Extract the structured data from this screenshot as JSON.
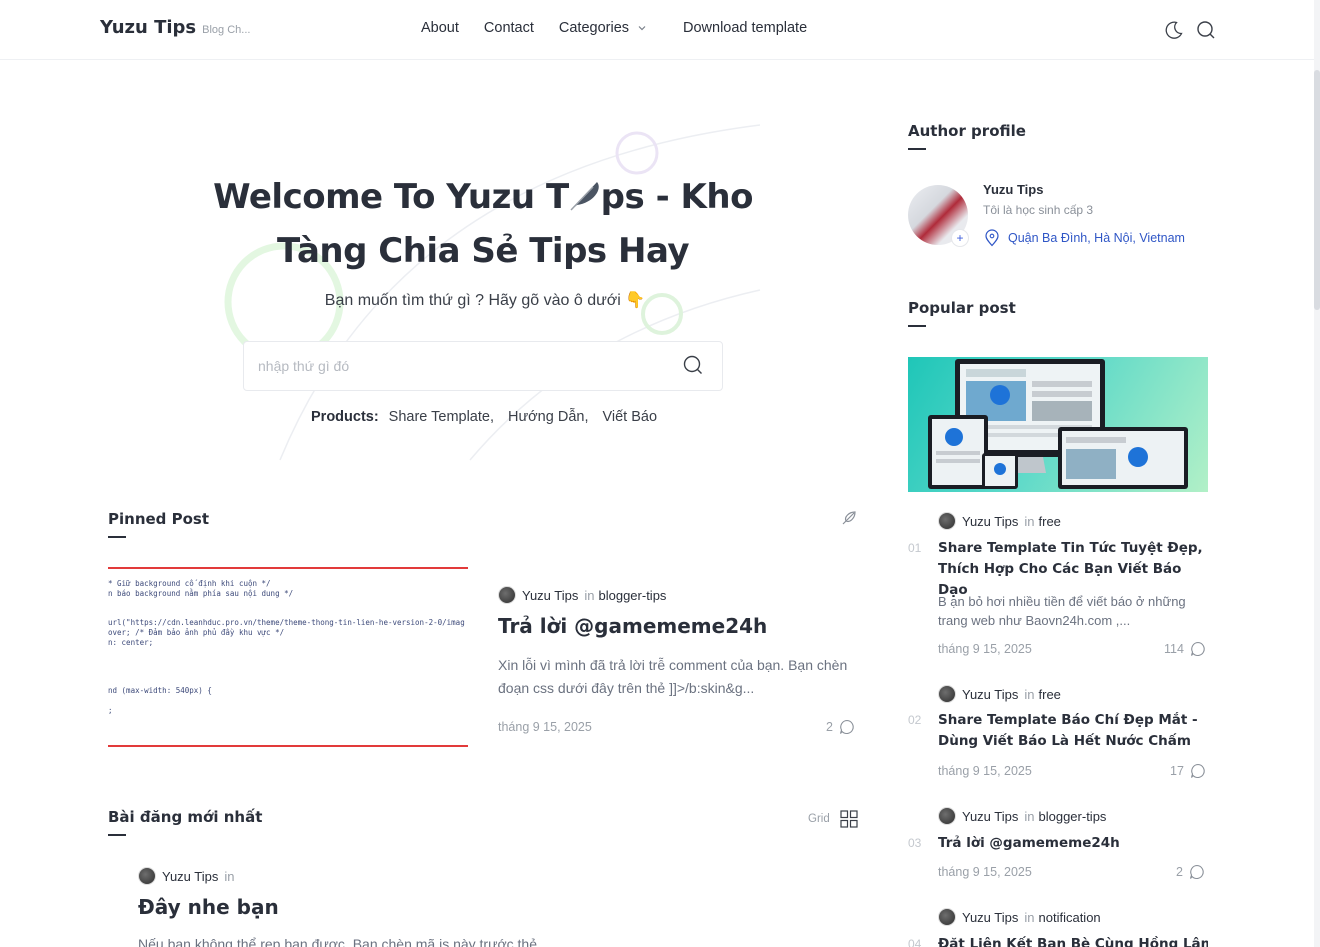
{
  "header": {
    "brand": "Yuzu Tips",
    "tagline": "Blog Ch...",
    "nav": [
      "About",
      "Contact",
      "Categories",
      "Download template"
    ],
    "icons": [
      "moon-icon",
      "search-icon"
    ]
  },
  "hero": {
    "title_line1_a": "Welcome To Yuzu T",
    "title_line1_b": "ps - Kho",
    "title_line2": "Tàng Chia Sẻ Tips Hay",
    "subtitle": "Bạn muốn tìm thứ gì ? Hãy gõ vào ô dưới 👇",
    "search_placeholder": "nhập thứ gì đó",
    "products_label": "Products:",
    "products": [
      "Share Template,",
      "Hướng Dẫn,",
      "Viết Báo"
    ]
  },
  "pinned": {
    "section_title": "Pinned Post",
    "code_lines": [
      "* Giữ background cố định khi cuộn */",
      "n báo background nằm phía sau nội dung */",
      "url(\"https://cdn.leanhduc.pro.vn/theme/theme-thong-tin-lien-he-version-2-0/imag",
      "over; /* Đảm bảo ảnh phủ đầy khu vực */",
      "n: center;",
      "nd (max-width: 540px) {",
      ";"
    ],
    "author": "Yuzu Tips",
    "in": "in",
    "category": "blogger-tips",
    "title": "Trả lời @gamememe24h",
    "excerpt": "Xin lỗi vì mình đã trả lời trễ comment của bạn. Bạn chèn đoạn css dưới đây trên thẻ  ]]>/b:skin&g...",
    "date": "tháng 9 15, 2025",
    "comments": "2"
  },
  "latest": {
    "section_title": "Bài đăng mới nhất",
    "view_label": "Grid",
    "author": "Yuzu Tips",
    "in": "in",
    "title": "Đây nhe bạn",
    "excerpt": "Nếu bạn không thể rep bạn được. Bạn chèn mã js này trước thẻ"
  },
  "sidebar": {
    "author_section": "Author profile",
    "author_name": "Yuzu Tips",
    "author_bio": "Tôi là học sinh cấp 3",
    "author_location": "Quận Ba Đình, Hà Nội, Vietnam",
    "popular_section": "Popular post",
    "popular": [
      {
        "num": "01",
        "author": "Yuzu Tips",
        "in": "in",
        "category": "free",
        "title": "Share Template Tin Tức Tuyệt Đẹp, Thích Hợp Cho Các Bạn Viết Báo Dạo",
        "excerpt": "B ạn bỏ hơi nhiều tiền để viết báo ở những trang web như Baovn24h.com ,...",
        "date": "tháng 9 15, 2025",
        "comments": "114"
      },
      {
        "num": "02",
        "author": "Yuzu Tips",
        "in": "in",
        "category": "free",
        "title": "Share Template Báo Chí Đẹp Mắt - Dùng Viết Báo Là Hết Nước Chấm",
        "date": "tháng 9 15, 2025",
        "comments": "17"
      },
      {
        "num": "03",
        "author": "Yuzu Tips",
        "in": "in",
        "category": "blogger-tips",
        "title": "Trả lời @gamememe24h",
        "date": "tháng 9 15, 2025",
        "comments": "2"
      },
      {
        "num": "04",
        "author": "Yuzu Tips",
        "in": "in",
        "category": "notification",
        "title": "Đặt Liên Kết Bạn Bè Cùng Hồng Lâm"
      }
    ]
  }
}
